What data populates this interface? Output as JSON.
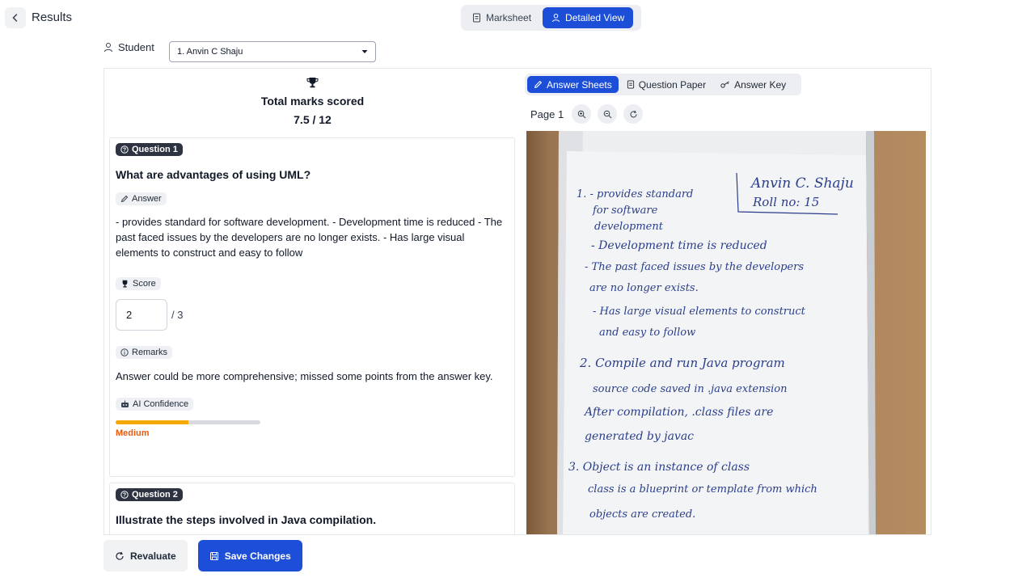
{
  "header": {
    "title": "Results",
    "tabs": [
      {
        "label": "Marksheet",
        "active": false
      },
      {
        "label": "Detailed View",
        "active": true
      }
    ]
  },
  "student": {
    "label": "Student",
    "selected": "1. Anvin C Shaju"
  },
  "summary": {
    "label": "Total marks scored",
    "value": "7.5 / 12"
  },
  "questions": [
    {
      "badge": "Question 1",
      "title": "What are advantages of using UML?",
      "answer_label": "Answer",
      "answer": "- provides standard for software development. - Development time is reduced - The past faced issues by the developers are no longer exists. - Has large visual elements to construct and easy to follow",
      "score_label": "Score",
      "score": "2",
      "max_score": "/ 3",
      "remarks_label": "Remarks",
      "remarks": "Answer could be more comprehensive; missed some points from the answer key.",
      "confidence_label": "AI Confidence",
      "confidence_level": "Medium",
      "confidence_fraction": 0.5
    },
    {
      "badge": "Question 2",
      "title": "Illustrate the steps involved in Java compilation."
    }
  ],
  "viewer": {
    "tabs": [
      {
        "label": "Answer Sheets",
        "active": true
      },
      {
        "label": "Question Paper",
        "active": false
      },
      {
        "label": "Answer Key",
        "active": false
      }
    ],
    "page_label": "Page 1",
    "handwriting": [
      "Anvin C. Shaju",
      "Roll no: 15",
      "1. - provides standard",
      "for software",
      "development",
      "- Development time is reduced",
      "- The past faced issues by the developers",
      "are no longer exists.",
      "- Has large visual elements to construct",
      "and easy to follow",
      "2. Compile and run Java program",
      "source code saved in .java extension",
      "After compilation, .class files are",
      "generated by javac",
      "3. Object is an instance of class",
      "class is a blueprint or template from which",
      "objects are created."
    ]
  },
  "actions": {
    "revaluate": "Revaluate",
    "save": "Save Changes"
  },
  "colors": {
    "primary": "#1d4ed8",
    "confidence_fill": "#f5a800",
    "confidence_text": "#ea580c",
    "badge_dark": "#2d3340"
  }
}
